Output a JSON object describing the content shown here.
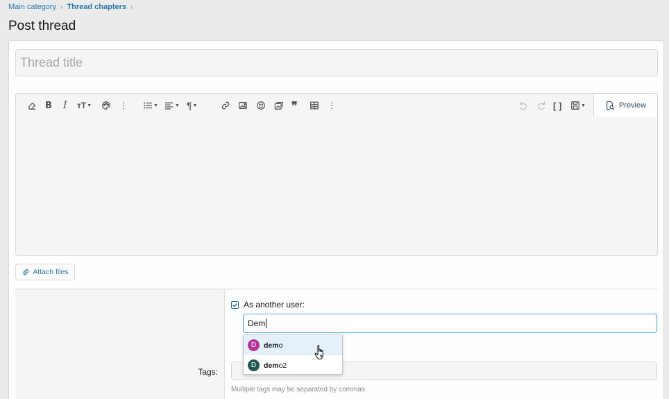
{
  "breadcrumb": {
    "items": [
      "Main category",
      "Thread chapters"
    ],
    "separator": "›"
  },
  "page": {
    "title": "Post thread"
  },
  "form": {
    "title_placeholder": "Thread title",
    "title_value": "",
    "preview_label": "Preview",
    "attach_label": "Attach files",
    "as_another_user_label": "As another user:",
    "as_another_user_checked": true,
    "user_input_value": "Dem",
    "tags_label": "Tags:",
    "tags_hint": "Multiple tags may be separated by commas."
  },
  "toolbar": {
    "left": [
      "eraser-icon",
      "bold-icon",
      "italic-icon",
      "text-size-icon",
      "palette-icon",
      "more-icon",
      "list-icon",
      "align-icon",
      "paragraph-icon",
      "link-icon",
      "image-icon",
      "smilie-icon",
      "media-icon",
      "quote-icon",
      "table-icon",
      "more-icon"
    ],
    "right": [
      "undo-icon",
      "redo-icon",
      "bbcode-icon",
      "drafts-icon"
    ]
  },
  "suggestions": [
    {
      "initial": "D",
      "match": "dem",
      "rest": "o",
      "avatar_color": "#b8329c",
      "highlighted": true
    },
    {
      "initial": "D",
      "match": "dem",
      "rest": "o2",
      "avatar_color": "#1f5a57",
      "highlighted": false
    }
  ],
  "colors": {
    "link": "#2577b1",
    "focus_border": "#47a7eb",
    "highlight": "#e4f1fb"
  }
}
